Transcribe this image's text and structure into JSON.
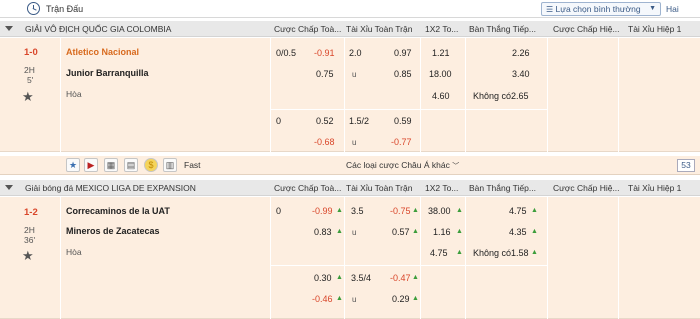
{
  "topbar": {
    "title": "Trận Đấu",
    "sort_label": "Lựa chọn bình thường",
    "hide_label": "Hai"
  },
  "columns": [
    "Cược Chấp Toà...",
    "Tài Xỉu Toàn Trận",
    "1X2 To...",
    "Bàn Thắng Tiếp...",
    "Cược Chấp Hiệ...",
    "Tài Xỉu Hiệp 1"
  ],
  "league1": {
    "name": "GIẢI VÔ ĐỊCH QUỐC GIA COLOMBIA",
    "columns": [
      "Cược Chấp Toà...",
      "Tài Xỉu Toàn Trận",
      "1X2 To...",
      "Bàn Thắng Tiếp...",
      "Cược Chấp Hiệ...",
      "Tài Xỉu Hiệp 1"
    ]
  },
  "match1": {
    "score": "1-0",
    "period": "2H",
    "minute": "5'",
    "home": "Atletico Nacional",
    "away": "Junior Barranquilla",
    "draw": "Hòa",
    "row1": {
      "hdp": "0/0.5",
      "hdp_odd": "-0.91",
      "ou": "2.0",
      "ou_odd": "0.97",
      "x12": "1.21",
      "next": "2.26"
    },
    "row2": {
      "hdp_odd": "0.75",
      "ou": "u",
      "ou_odd": "0.85",
      "x12": "18.00",
      "next": "3.40"
    },
    "row3": {
      "x12": "4.60",
      "next_label": "Không có",
      "next": "2.65"
    },
    "alt1": {
      "hdp": "0",
      "hdp_odd": "0.52",
      "ou": "1.5/2",
      "ou_odd": "0.59"
    },
    "alt2": {
      "hdp_odd": "-0.68",
      "ou": "u",
      "ou_odd": "-0.77"
    },
    "more_label": "Các loại cược Châu Á khác",
    "count": "53",
    "fast_label": "Fast"
  },
  "league2": {
    "name": "Giải bóng đá MEXICO LIGA DE EXPANSION",
    "columns": [
      "Cược Chấp Toà...",
      "Tài Xỉu Toàn Trận",
      "1X2 To...",
      "Bàn Thắng Tiếp...",
      "Cược Chấp Hiệ...",
      "Tài Xỉu Hiệp 1"
    ]
  },
  "match2": {
    "score": "1-2",
    "period": "2H",
    "minute": "36'",
    "home": "Correcaminos de la UAT",
    "away": "Mineros de Zacatecas",
    "draw": "Hòa",
    "row1": {
      "hdp": "0",
      "hdp_odd": "-0.99",
      "ou": "3.5",
      "ou_odd": "-0.75",
      "x12": "38.00",
      "next": "4.75"
    },
    "row2": {
      "hdp_odd": "0.83",
      "ou": "u",
      "ou_odd": "0.57",
      "x12": "1.16",
      "next": "4.35"
    },
    "row3": {
      "x12": "4.75",
      "next_label": "Không có",
      "next": "1.58"
    },
    "alt1": {
      "hdp_odd": "0.30",
      "ou": "3.5/4",
      "ou_odd": "-0.47"
    },
    "alt2": {
      "hdp_odd": "-0.46",
      "ou": "u",
      "ou_odd": "0.29"
    }
  },
  "colors": {
    "accent": "#d9462a",
    "favourite": "#d86a1e",
    "row_bg": "#fdeee0",
    "league_bg": "#e8e8e8",
    "up": "#3b9d3b"
  }
}
